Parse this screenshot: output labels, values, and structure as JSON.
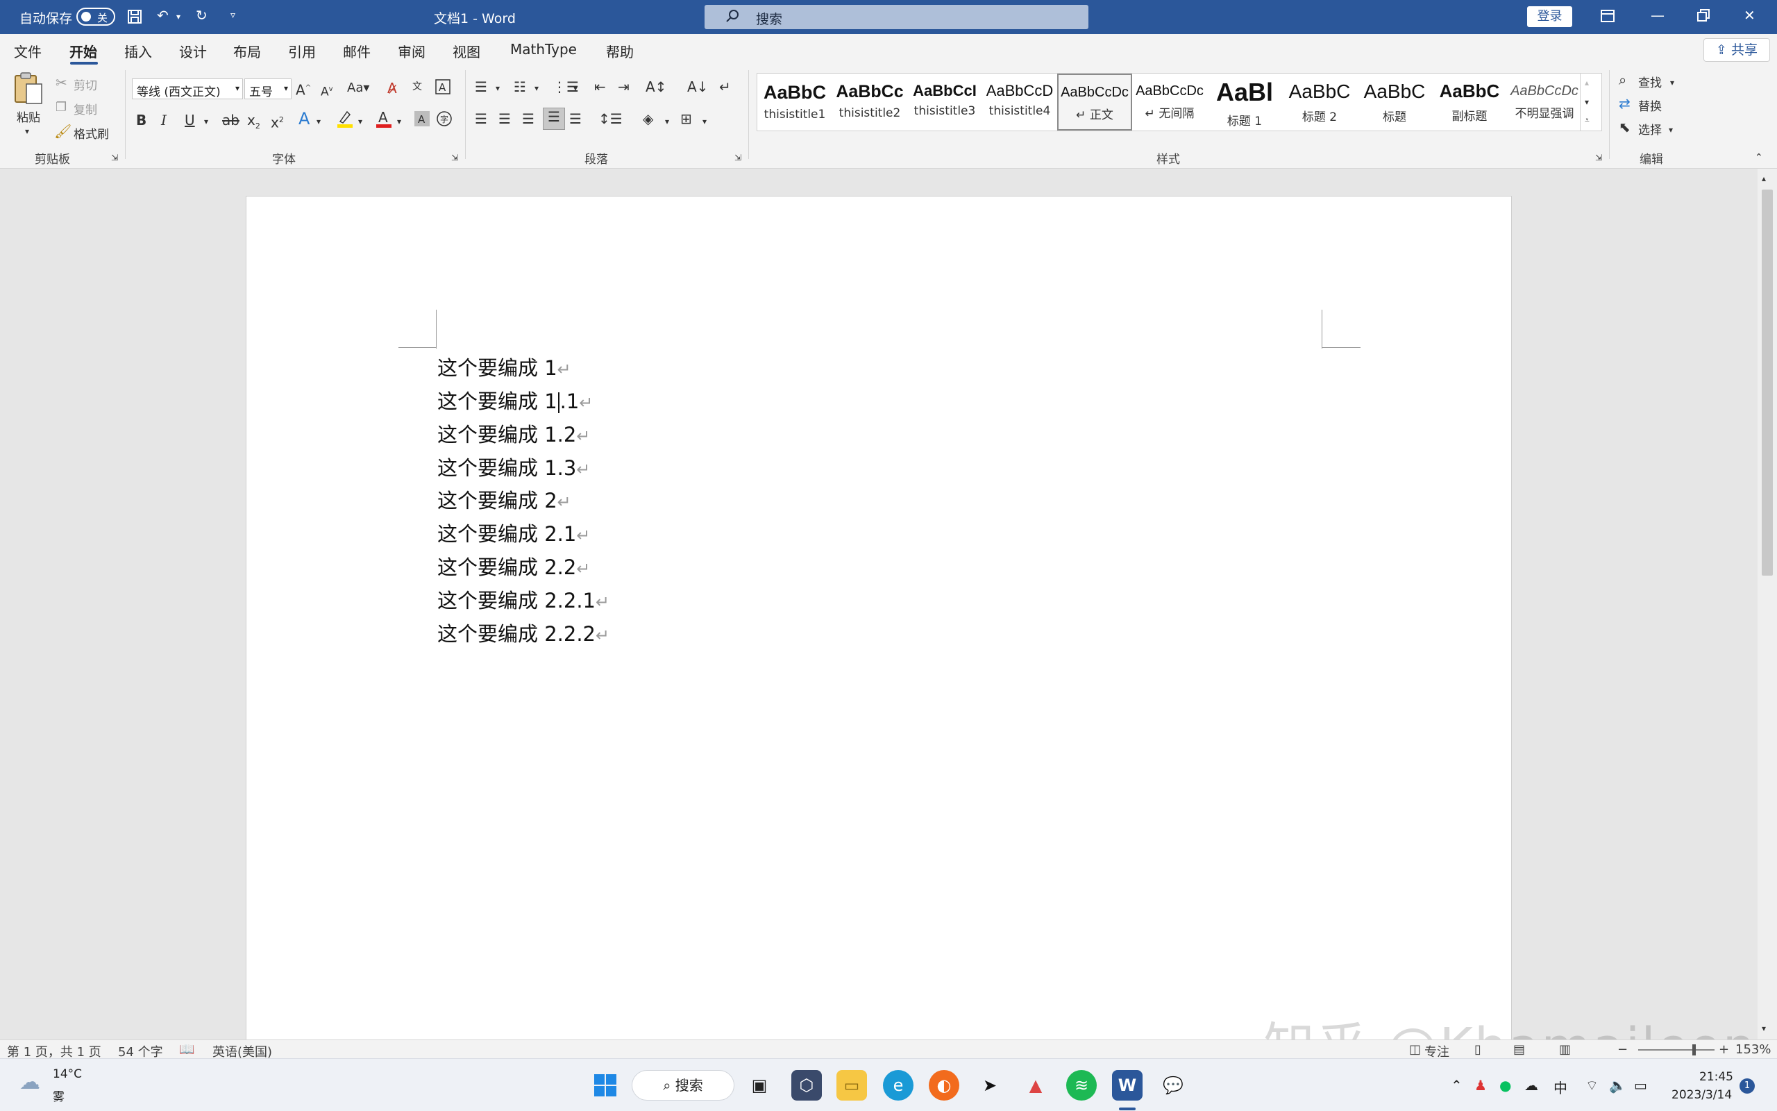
{
  "titlebar": {
    "autosave_label": "自动保存",
    "autosave_state": "关",
    "doc_title": "文档1",
    "separator": "-",
    "app_name": "Word",
    "search_placeholder": "搜索",
    "login_label": "登录"
  },
  "menu": {
    "tabs": [
      "文件",
      "开始",
      "插入",
      "设计",
      "布局",
      "引用",
      "邮件",
      "审阅",
      "视图",
      "MathType",
      "帮助"
    ],
    "active_tab": "开始",
    "share_label": "共享"
  },
  "ribbon": {
    "clipboard": {
      "paste": "粘贴",
      "cut": "剪切",
      "copy": "复制",
      "format_painter": "格式刷",
      "group_label": "剪贴板"
    },
    "font": {
      "font_name": "等线 (西文正文)",
      "font_size": "五号",
      "group_label": "字体"
    },
    "paragraph": {
      "group_label": "段落"
    },
    "styles": {
      "items": [
        {
          "preview": "AaBbC",
          "name": "thisistitle1"
        },
        {
          "preview": "AaBbCc",
          "name": "thisistitle2"
        },
        {
          "preview": "AaBbCcI",
          "name": "thisistitle3"
        },
        {
          "preview": "AaBbCcD",
          "name": "thisistitle4"
        },
        {
          "preview": "AaBbCcDc",
          "name": "↵ 正文"
        },
        {
          "preview": "AaBbCcDc",
          "name": "↵ 无间隔"
        },
        {
          "preview": "AaBl",
          "name": "标题 1"
        },
        {
          "preview": "AaBbC",
          "name": "标题 2"
        },
        {
          "preview": "AaBbC",
          "name": "标题"
        },
        {
          "preview": "AaBbC",
          "name": "副标题"
        },
        {
          "preview": "AaBbCcDc",
          "name": "不明显强调"
        }
      ],
      "selected": "↵ 正文",
      "group_label": "样式"
    },
    "editing": {
      "find": "查找",
      "replace": "替换",
      "select": "选择",
      "group_label": "编辑"
    }
  },
  "document": {
    "lines": [
      "这个要编成 1",
      "这个要编成 1.1",
      "这个要编成 1.2",
      "这个要编成 1.3",
      "这个要编成 2",
      "这个要编成 2.1",
      "这个要编成 2.2",
      "这个要编成 2.2.1",
      "这个要编成 2.2.2"
    ],
    "line_1_1_before_cursor": "这个要编成 1",
    "line_1_1_after_cursor": ".1",
    "paragraph_mark": "↵"
  },
  "statusbar": {
    "page": "第 1 页，共 1 页",
    "word_count": "54 个字",
    "language": "英语(美国)",
    "focus": "专注",
    "zoom": "153%"
  },
  "watermark": "知乎 @Khamaileon",
  "taskbar": {
    "weather_temp": "14°C",
    "weather_desc": "雾",
    "search_label": "搜索",
    "ime": "中",
    "time": "21:45",
    "date": "2023/3/14",
    "notification_count": "1"
  },
  "colors": {
    "word_blue": "#2b579a",
    "ribbon_bg": "#f3f3f3"
  }
}
